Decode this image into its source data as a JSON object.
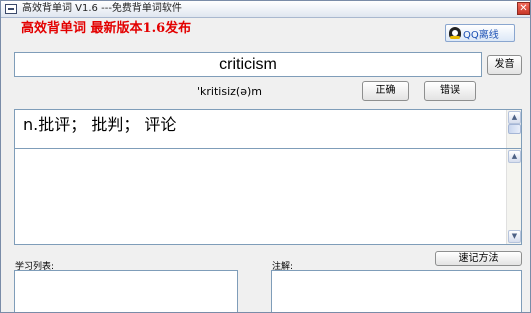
{
  "window": {
    "title": "高效背单词 V1.6 ---免费背单词软件",
    "close_glyph": "✕"
  },
  "header": {
    "headline": "高效背单词  最新版本1.6发布",
    "qq_button": "QQ离线"
  },
  "word": {
    "text": "criticism",
    "phonetic": "'kritisiz(ə)m",
    "pronounce_button": "发音",
    "correct_button": "正确",
    "wrong_button": "错误"
  },
  "definition": {
    "text": "n.批评； 批判； 评论"
  },
  "bottom": {
    "list_label": "学习列表:",
    "note_label": "注解:",
    "memo_button": "速记方法"
  },
  "icons": {
    "qq": "qq-penguin-icon",
    "app": "app-window-icon",
    "scroll_up": "scroll-up-arrow-icon",
    "scroll_down": "scroll-down-arrow-icon"
  },
  "colors": {
    "headline": "#e30000",
    "qq_label": "#1a4fb3",
    "close_button": "#d4473a"
  }
}
